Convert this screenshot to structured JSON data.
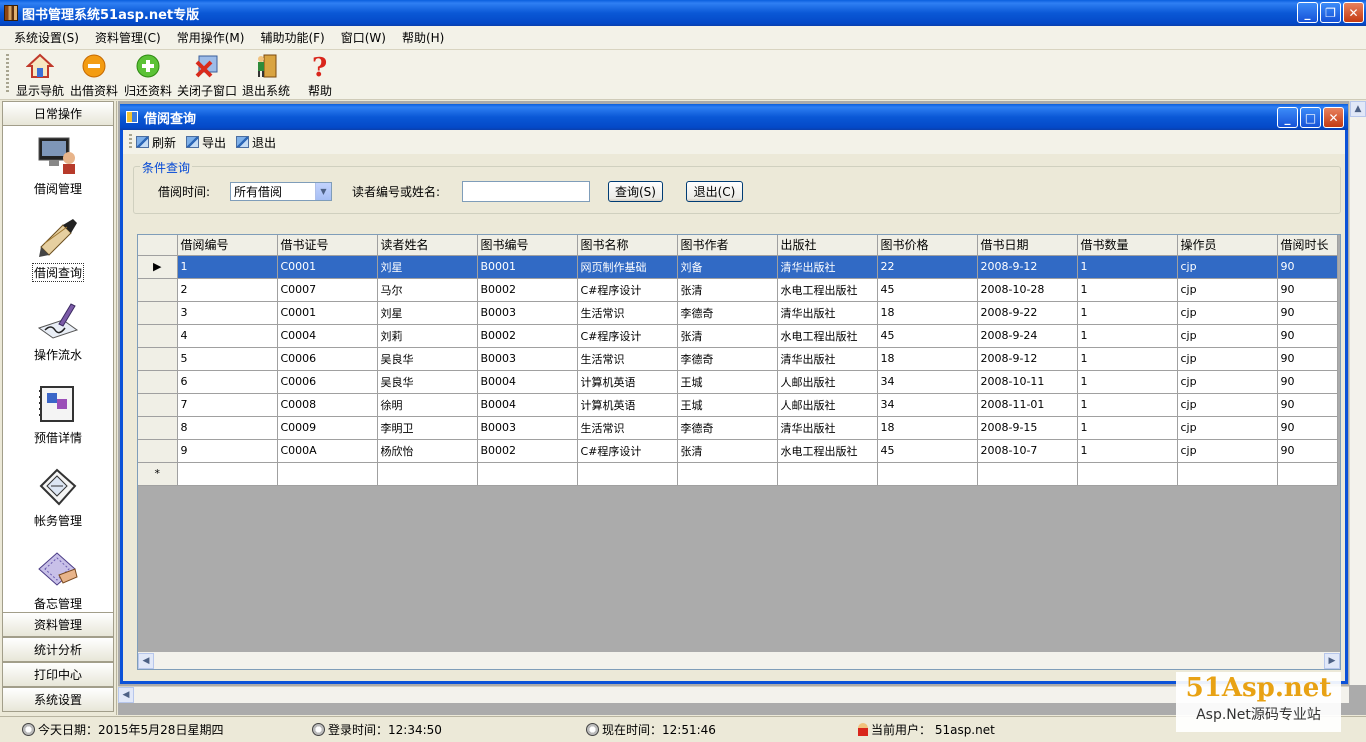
{
  "window": {
    "title": "图书管理系统51asp.net专版"
  },
  "menu": [
    "系统设置(S)",
    "资料管理(C)",
    "常用操作(M)",
    "辅助功能(F)",
    "窗口(W)",
    "帮助(H)"
  ],
  "toolbar": [
    {
      "label": "显示导航",
      "icon": "home-icon"
    },
    {
      "label": "出借资料",
      "icon": "minus-circle-icon"
    },
    {
      "label": "归还资料",
      "icon": "plus-circle-icon"
    },
    {
      "label": "关闭子窗口",
      "icon": "close-window-icon"
    },
    {
      "label": "退出系统",
      "icon": "exit-door-icon"
    },
    {
      "label": "帮助",
      "icon": "help-question-icon"
    }
  ],
  "nav": {
    "sections": [
      "日常操作",
      "资料管理",
      "统计分析",
      "打印中心",
      "系统设置"
    ],
    "tiles": [
      {
        "label": "借阅管理",
        "icon": "person-computer-icon"
      },
      {
        "label": "借阅查询",
        "icon": "pen-book-icon"
      },
      {
        "label": "操作流水",
        "icon": "signature-icon"
      },
      {
        "label": "预借详情",
        "icon": "notebook-icon"
      },
      {
        "label": "帐务管理",
        "icon": "ledger-icon"
      },
      {
        "label": "备忘管理",
        "icon": "memo-icon"
      }
    ]
  },
  "child": {
    "title": "借阅查询",
    "tools": [
      "刷新",
      "导出",
      "退出"
    ],
    "group_title": "条件查询",
    "time_label": "借阅时间:",
    "time_value": "所有借阅",
    "reader_label": "读者编号或姓名:",
    "reader_value": "",
    "query_button": "查询(S)",
    "exit_button": "退出(C)"
  },
  "grid": {
    "columns": [
      "借阅编号",
      "借书证号",
      "读者姓名",
      "图书编号",
      "图书名称",
      "图书作者",
      "出版社",
      "图书价格",
      "借书日期",
      "借书数量",
      "操作员",
      "借阅时长"
    ],
    "rows": [
      [
        "1",
        "C0001",
        "刘星",
        "B0001",
        "网页制作基础",
        "刘备",
        "清华出版社",
        "22",
        "2008-9-12",
        "1",
        "cjp",
        "90"
      ],
      [
        "2",
        "C0007",
        "马尔",
        "B0002",
        "C#程序设计",
        "张清",
        "水电工程出版社",
        "45",
        "2008-10-28",
        "1",
        "cjp",
        "90"
      ],
      [
        "3",
        "C0001",
        "刘星",
        "B0003",
        "生活常识",
        "李德奇",
        "清华出版社",
        "18",
        "2008-9-22",
        "1",
        "cjp",
        "90"
      ],
      [
        "4",
        "C0004",
        "刘莉",
        "B0002",
        "C#程序设计",
        "张清",
        "水电工程出版社",
        "45",
        "2008-9-24",
        "1",
        "cjp",
        "90"
      ],
      [
        "5",
        "C0006",
        "吴良华",
        "B0003",
        "生活常识",
        "李德奇",
        "清华出版社",
        "18",
        "2008-9-12",
        "1",
        "cjp",
        "90"
      ],
      [
        "6",
        "C0006",
        "吴良华",
        "B0004",
        "计算机英语",
        "王城",
        "人邮出版社",
        "34",
        "2008-10-11",
        "1",
        "cjp",
        "90"
      ],
      [
        "7",
        "C0008",
        "徐明",
        "B0004",
        "计算机英语",
        "王城",
        "人邮出版社",
        "34",
        "2008-11-01",
        "1",
        "cjp",
        "90"
      ],
      [
        "8",
        "C0009",
        "李明卫",
        "B0003",
        "生活常识",
        "李德奇",
        "清华出版社",
        "18",
        "2008-9-15",
        "1",
        "cjp",
        "90"
      ],
      [
        "9",
        "C000A",
        "杨欣怡",
        "B0002",
        "C#程序设计",
        "张清",
        "水电工程出版社",
        "45",
        "2008-10-7",
        "1",
        "cjp",
        "90"
      ]
    ],
    "selected_row_marker": "▶",
    "new_row_marker": "*"
  },
  "status": {
    "date": "今天日期：2015年5月28日星期四",
    "login": "登录时间：12:34:50",
    "now": "现在时间：12:51:46",
    "user": "当前用户： 51asp.net"
  },
  "watermark": {
    "line1": "51Asp.net",
    "line2": "Asp.Net源码专业站"
  },
  "colors": {
    "title_blue": "#0A58D6",
    "selection": "#316AC5",
    "group_title": "#0046D5"
  }
}
